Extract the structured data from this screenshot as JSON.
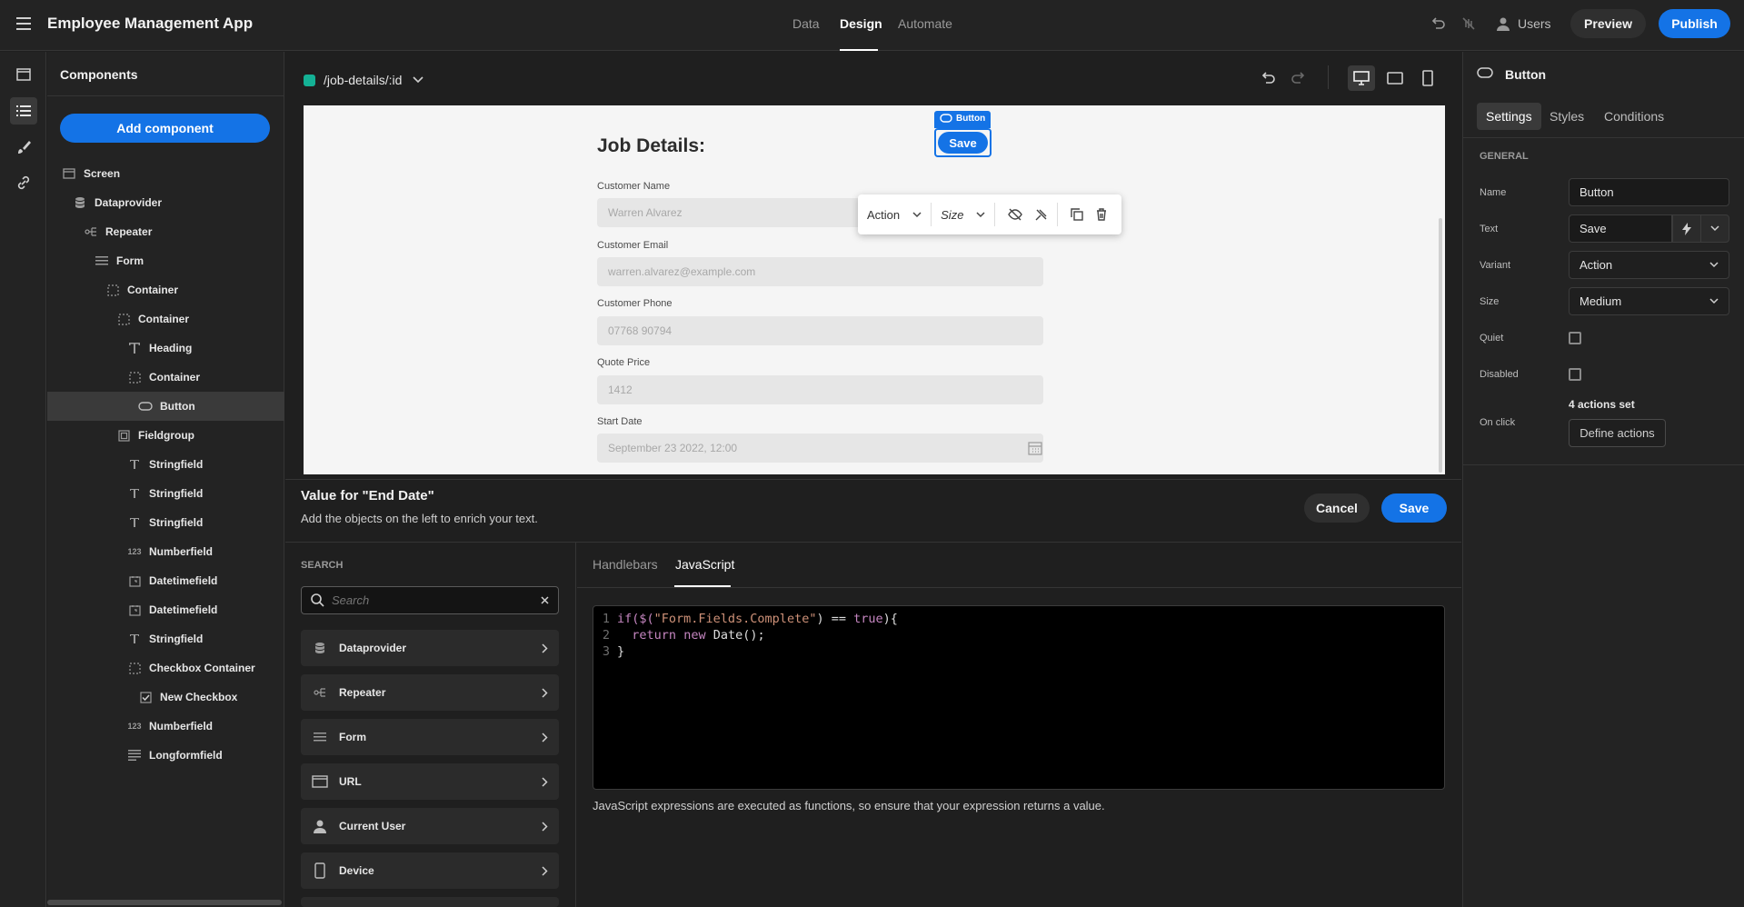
{
  "app": {
    "title": "Employee Management App"
  },
  "nav": {
    "tabs": [
      "Data",
      "Design",
      "Automate"
    ],
    "users_label": "Users",
    "preview_label": "Preview",
    "publish_label": "Publish"
  },
  "components": {
    "title": "Components",
    "add_label": "Add component",
    "tree": [
      {
        "label": "Screen",
        "icon": "screen-icon",
        "indent": 0
      },
      {
        "label": "Dataprovider",
        "icon": "database-icon",
        "indent": 1
      },
      {
        "label": "Repeater",
        "icon": "repeater-icon",
        "indent": 2
      },
      {
        "label": "Form",
        "icon": "form-icon",
        "indent": 3
      },
      {
        "label": "Container",
        "icon": "container-icon",
        "indent": 4
      },
      {
        "label": "Container",
        "icon": "container-icon",
        "indent": 5
      },
      {
        "label": "Heading",
        "icon": "heading-icon",
        "indent": 6
      },
      {
        "label": "Container",
        "icon": "container-icon",
        "indent": 6
      },
      {
        "label": "Button",
        "icon": "button-icon",
        "indent": 7,
        "selected": true
      },
      {
        "label": "Fieldgroup",
        "icon": "fieldgroup-icon",
        "indent": 5
      },
      {
        "label": "Stringfield",
        "icon": "text-icon",
        "indent": 6
      },
      {
        "label": "Stringfield",
        "icon": "text-icon",
        "indent": 6
      },
      {
        "label": "Stringfield",
        "icon": "text-icon",
        "indent": 6
      },
      {
        "label": "Numberfield",
        "icon": "number-icon",
        "indent": 6
      },
      {
        "label": "Datetimefield",
        "icon": "calendar-icon",
        "indent": 6
      },
      {
        "label": "Datetimefield",
        "icon": "calendar-icon",
        "indent": 6
      },
      {
        "label": "Stringfield",
        "icon": "text-icon",
        "indent": 6
      },
      {
        "label": "Checkbox Container",
        "icon": "container-icon",
        "indent": 6
      },
      {
        "label": "New Checkbox",
        "icon": "checkbox-icon",
        "indent": 7
      },
      {
        "label": "Numberfield",
        "icon": "number-icon",
        "indent": 6
      },
      {
        "label": "Longformfield",
        "icon": "longform-icon",
        "indent": 6
      }
    ]
  },
  "canvas": {
    "route": "/job-details/:id",
    "heading": "Job Details:",
    "button_tag": "Button",
    "save_label": "Save",
    "toolbar": {
      "action": "Action",
      "size": "Size"
    },
    "fields": [
      {
        "label": "Customer Name",
        "placeholder": "Warren Alvarez"
      },
      {
        "label": "Customer Email",
        "placeholder": "warren.alvarez@example.com"
      },
      {
        "label": "Customer Phone",
        "placeholder": "07768 90794"
      },
      {
        "label": "Quote Price",
        "placeholder": "1412"
      },
      {
        "label": "Start Date",
        "placeholder": "September 23 2022, 12:00"
      }
    ]
  },
  "settings": {
    "component": "Button",
    "tabs": [
      "Settings",
      "Styles",
      "Conditions"
    ],
    "section": "GENERAL",
    "name_label": "Name",
    "name_value": "Button",
    "text_label": "Text",
    "text_value": "Save",
    "variant_label": "Variant",
    "variant_value": "Action",
    "size_label": "Size",
    "size_value": "Medium",
    "quiet_label": "Quiet",
    "disabled_label": "Disabled",
    "actions_set": "4 actions set",
    "onclick_label": "On click",
    "define_label": "Define actions"
  },
  "binding": {
    "title": "Value for \"End Date\"",
    "subtitle": "Add the objects on the left to enrich your text.",
    "cancel_label": "Cancel",
    "save_label": "Save",
    "search_label": "SEARCH",
    "search_placeholder": "Search",
    "categories": [
      {
        "label": "Dataprovider",
        "icon": "database-icon"
      },
      {
        "label": "Repeater",
        "icon": "repeater-icon"
      },
      {
        "label": "Form",
        "icon": "form-icon"
      },
      {
        "label": "URL",
        "icon": "url-icon"
      },
      {
        "label": "Current User",
        "icon": "user-icon"
      },
      {
        "label": "Device",
        "icon": "device-icon"
      }
    ],
    "editor_tabs": [
      "Handlebars",
      "JavaScript"
    ],
    "code_lines": [
      "1",
      "2",
      "3"
    ],
    "code": {
      "l1_a": "if($(",
      "l1_str": "\"Form.Fields.Complete\"",
      "l1_b": ") == ",
      "l1_true": "true",
      "l1_c": "){",
      "l2_indent": "  ",
      "l2_kw1": "return",
      "l2_sp": " ",
      "l2_kw2": "new",
      "l2_rest": " Date();",
      "l3": "}"
    },
    "note": "JavaScript expressions are executed as functions, so ensure that your expression returns a value."
  },
  "colors": {
    "accent": "#1473e6",
    "route_badge": "#14b195"
  }
}
